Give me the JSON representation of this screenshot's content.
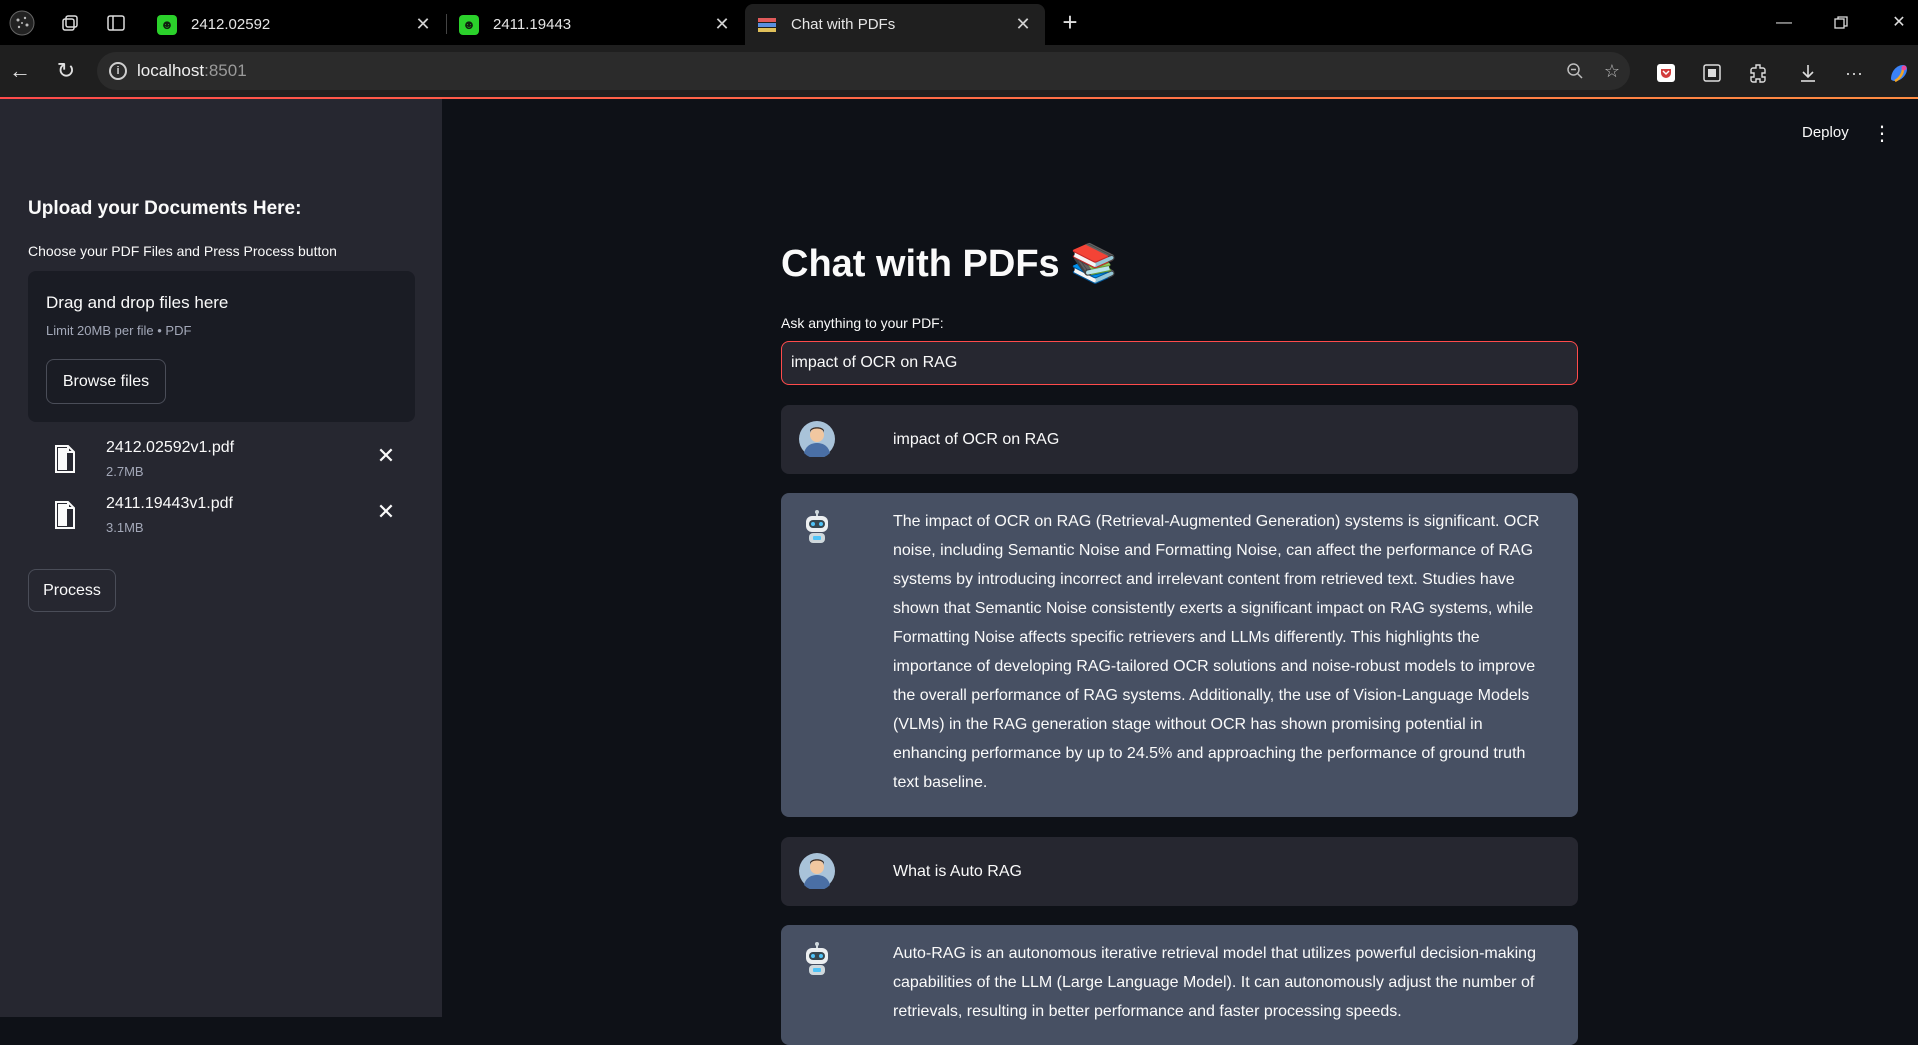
{
  "browser": {
    "tabs": [
      {
        "title": "2412.02592"
      },
      {
        "title": "2411.19443"
      },
      {
        "title": "Chat with PDFs"
      }
    ],
    "address": {
      "host": "localhost",
      "port": ":8501"
    }
  },
  "sidebar": {
    "title": "Upload your Documents Here:",
    "subtitle": "Choose your PDF Files and Press Process button",
    "dropzone": {
      "title": "Drag and drop files here",
      "limit": "Limit 20MB per file • PDF",
      "browse_label": "Browse files"
    },
    "files": [
      {
        "name": "2412.02592v1.pdf",
        "size": "2.7MB"
      },
      {
        "name": "2411.19443v1.pdf",
        "size": "3.1MB"
      }
    ],
    "process_label": "Process"
  },
  "header": {
    "deploy_label": "Deploy"
  },
  "main": {
    "title": "Chat with PDFs 📚",
    "input_label": "Ask anything to your PDF:",
    "input_value": "impact of OCR on RAG",
    "messages": [
      {
        "role": "user",
        "text": "impact of OCR on RAG"
      },
      {
        "role": "bot",
        "text": "The impact of OCR on RAG (Retrieval-Augmented Generation) systems is significant. OCR noise, including Semantic Noise and Formatting Noise, can affect the performance of RAG systems by introducing incorrect and irrelevant content from retrieved text. Studies have shown that Semantic Noise consistently exerts a significant impact on RAG systems, while Formatting Noise affects specific retrievers and LLMs differently. This highlights the importance of developing RAG-tailored OCR solutions and noise-robust models to improve the overall performance of RAG systems. Additionally, the use of Vision-Language Models (VLMs) in the RAG generation stage without OCR has shown promising potential in enhancing performance by up to 24.5% and approaching the performance of ground truth text baseline."
      },
      {
        "role": "user",
        "text": "What is Auto RAG"
      },
      {
        "role": "bot",
        "text": "Auto-RAG is an autonomous iterative retrieval model that utilizes powerful decision-making capabilities of the LLM (Large Language Model). It can autonomously adjust the number of retrievals, resulting in better performance and faster processing speeds."
      }
    ]
  }
}
